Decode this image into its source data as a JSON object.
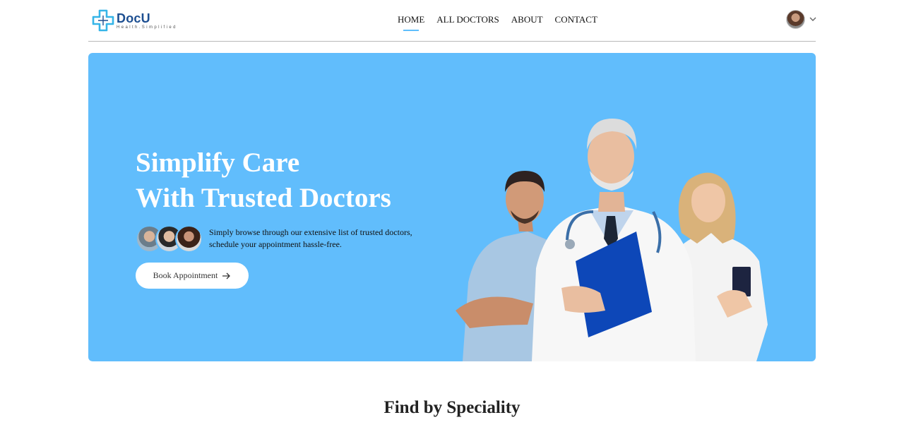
{
  "brand": {
    "name": "DocU",
    "tagline": "Health.Simplified",
    "mark_color": "#36b5e8"
  },
  "nav": {
    "links": [
      {
        "label": "HOME",
        "active": true
      },
      {
        "label": "ALL DOCTORS",
        "active": false
      },
      {
        "label": "ABOUT",
        "active": false
      },
      {
        "label": "CONTACT",
        "active": false
      }
    ],
    "active_underline_color": "#5fbefc"
  },
  "profile": {
    "avatar_icon": "user-avatar",
    "dropdown_icon": "chevron-down-icon"
  },
  "hero": {
    "background_color": "#61bdfc",
    "title_line1": "Simplify Care",
    "title_line2": "With Trusted Doctors",
    "description_line1": "Simply browse through our extensive list of trusted doctors,",
    "description_line2": "schedule your appointment hassle-free.",
    "cta_label": "Book Appointment",
    "cta_icon": "arrow-right-icon",
    "image_alt": "doctors-group"
  },
  "sections": {
    "speciality_title": "Find by Speciality"
  }
}
